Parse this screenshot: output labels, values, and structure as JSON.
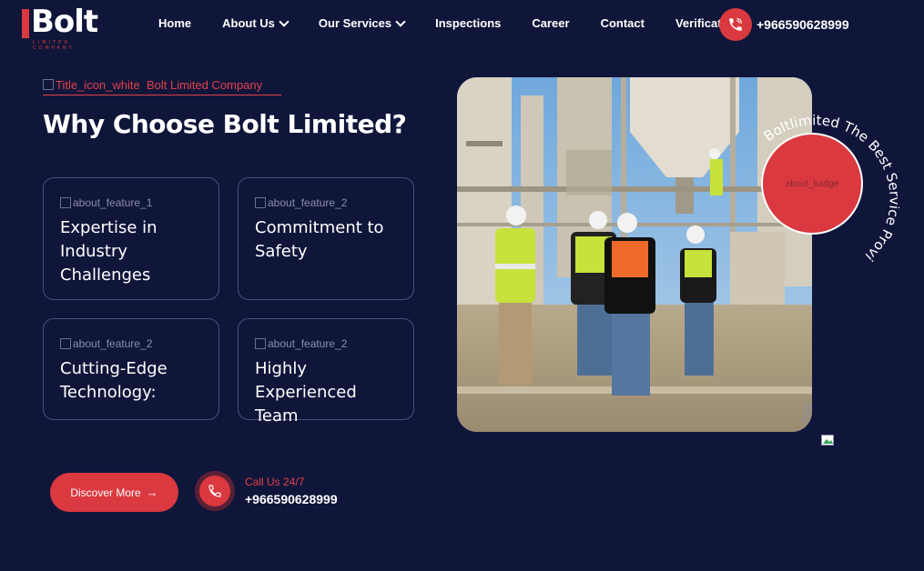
{
  "brand": {
    "logo_text": "Bolt",
    "logo_sub": "LIMITED COMPANY"
  },
  "nav": {
    "items": [
      {
        "label": "Home",
        "dropdown": false
      },
      {
        "label": "About Us",
        "dropdown": true
      },
      {
        "label": "Our Services",
        "dropdown": true
      },
      {
        "label": "Inspections",
        "dropdown": false
      },
      {
        "label": "Career",
        "dropdown": false
      },
      {
        "label": "Contact",
        "dropdown": false
      },
      {
        "label": "Verification",
        "dropdown": false
      }
    ],
    "phone": "+966590628999",
    "phone_icon": "phone-ringing-icon"
  },
  "section": {
    "tag_img_alt": "Title_icon_white",
    "tag_text": "Bolt Limited Company",
    "title": "Why Choose Bolt Limited?"
  },
  "features": [
    {
      "img_alt": "about_feature_1",
      "title": "Expertise in Industry Challenges"
    },
    {
      "img_alt": "about_feature_2",
      "title": "Commitment to Safety"
    },
    {
      "img_alt": "about_feature_2",
      "title": "Cutting-Edge Technology:"
    },
    {
      "img_alt": "about_feature_2",
      "title": "Highly Experienced Team"
    }
  ],
  "cta": {
    "discover_label": "Discover More",
    "call_label": "Call Us 24/7",
    "call_number": "+966590628999"
  },
  "media": {
    "badge_img_alt": "about_badge",
    "circular_text": "Boltlimited The Best Service Provider",
    "story_alt": "story"
  },
  "colors": {
    "background": "#10163a",
    "accent": "#d9393f",
    "card_border": "#4a5177"
  }
}
